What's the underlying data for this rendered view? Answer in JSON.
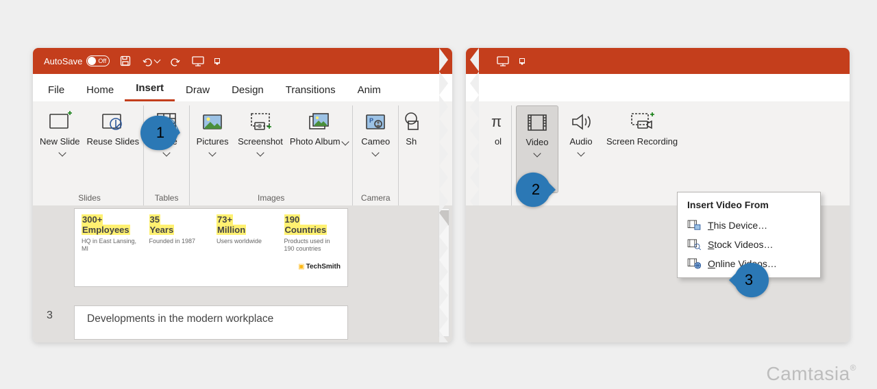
{
  "titlebar": {
    "autosave_label": "AutoSave",
    "autosave_state": "Off"
  },
  "tabs": [
    "File",
    "Home",
    "Insert",
    "Draw",
    "Design",
    "Transitions",
    "Anim"
  ],
  "active_tab": "Insert",
  "groups_left": {
    "slides": {
      "label": "Slides",
      "new_slide": "New Slide",
      "reuse": "Reuse Slides"
    },
    "tables": {
      "label": "Tables",
      "table": "Table"
    },
    "images": {
      "label": "Images",
      "pictures": "Pictures",
      "screenshot": "Screenshot",
      "album": "Photo Album"
    },
    "camera": {
      "label": "Camera",
      "cameo": "Cameo"
    },
    "shapes_cut": "Sh"
  },
  "groups_right": {
    "symbol_cut": "ol",
    "media": {
      "video": "Video",
      "audio": "Audio",
      "screenrec": "Screen Recording"
    }
  },
  "slide_preview": {
    "stats": [
      {
        "value": "300+",
        "value2": "Employees",
        "desc": "HQ in East Lansing, MI"
      },
      {
        "value": "35",
        "value2": "Years",
        "desc": "Founded in 1987"
      },
      {
        "value": "73+",
        "value2": "Million",
        "desc": "Users worldwide"
      },
      {
        "value": "190",
        "value2": "Countries",
        "desc": "Products used in 190 countries"
      }
    ],
    "brand": "TechSmith",
    "slide_number": "3",
    "next_title": "Developments in the modern workplace"
  },
  "video_menu": {
    "title": "Insert Video From",
    "items": [
      {
        "key": "T",
        "rest": "his Device…"
      },
      {
        "key": "S",
        "rest": "tock Videos…"
      },
      {
        "key": "O",
        "rest": "nline Videos…"
      }
    ]
  },
  "callouts": {
    "c1": "1",
    "c2": "2",
    "c3": "3"
  },
  "watermark": "Camtasia"
}
